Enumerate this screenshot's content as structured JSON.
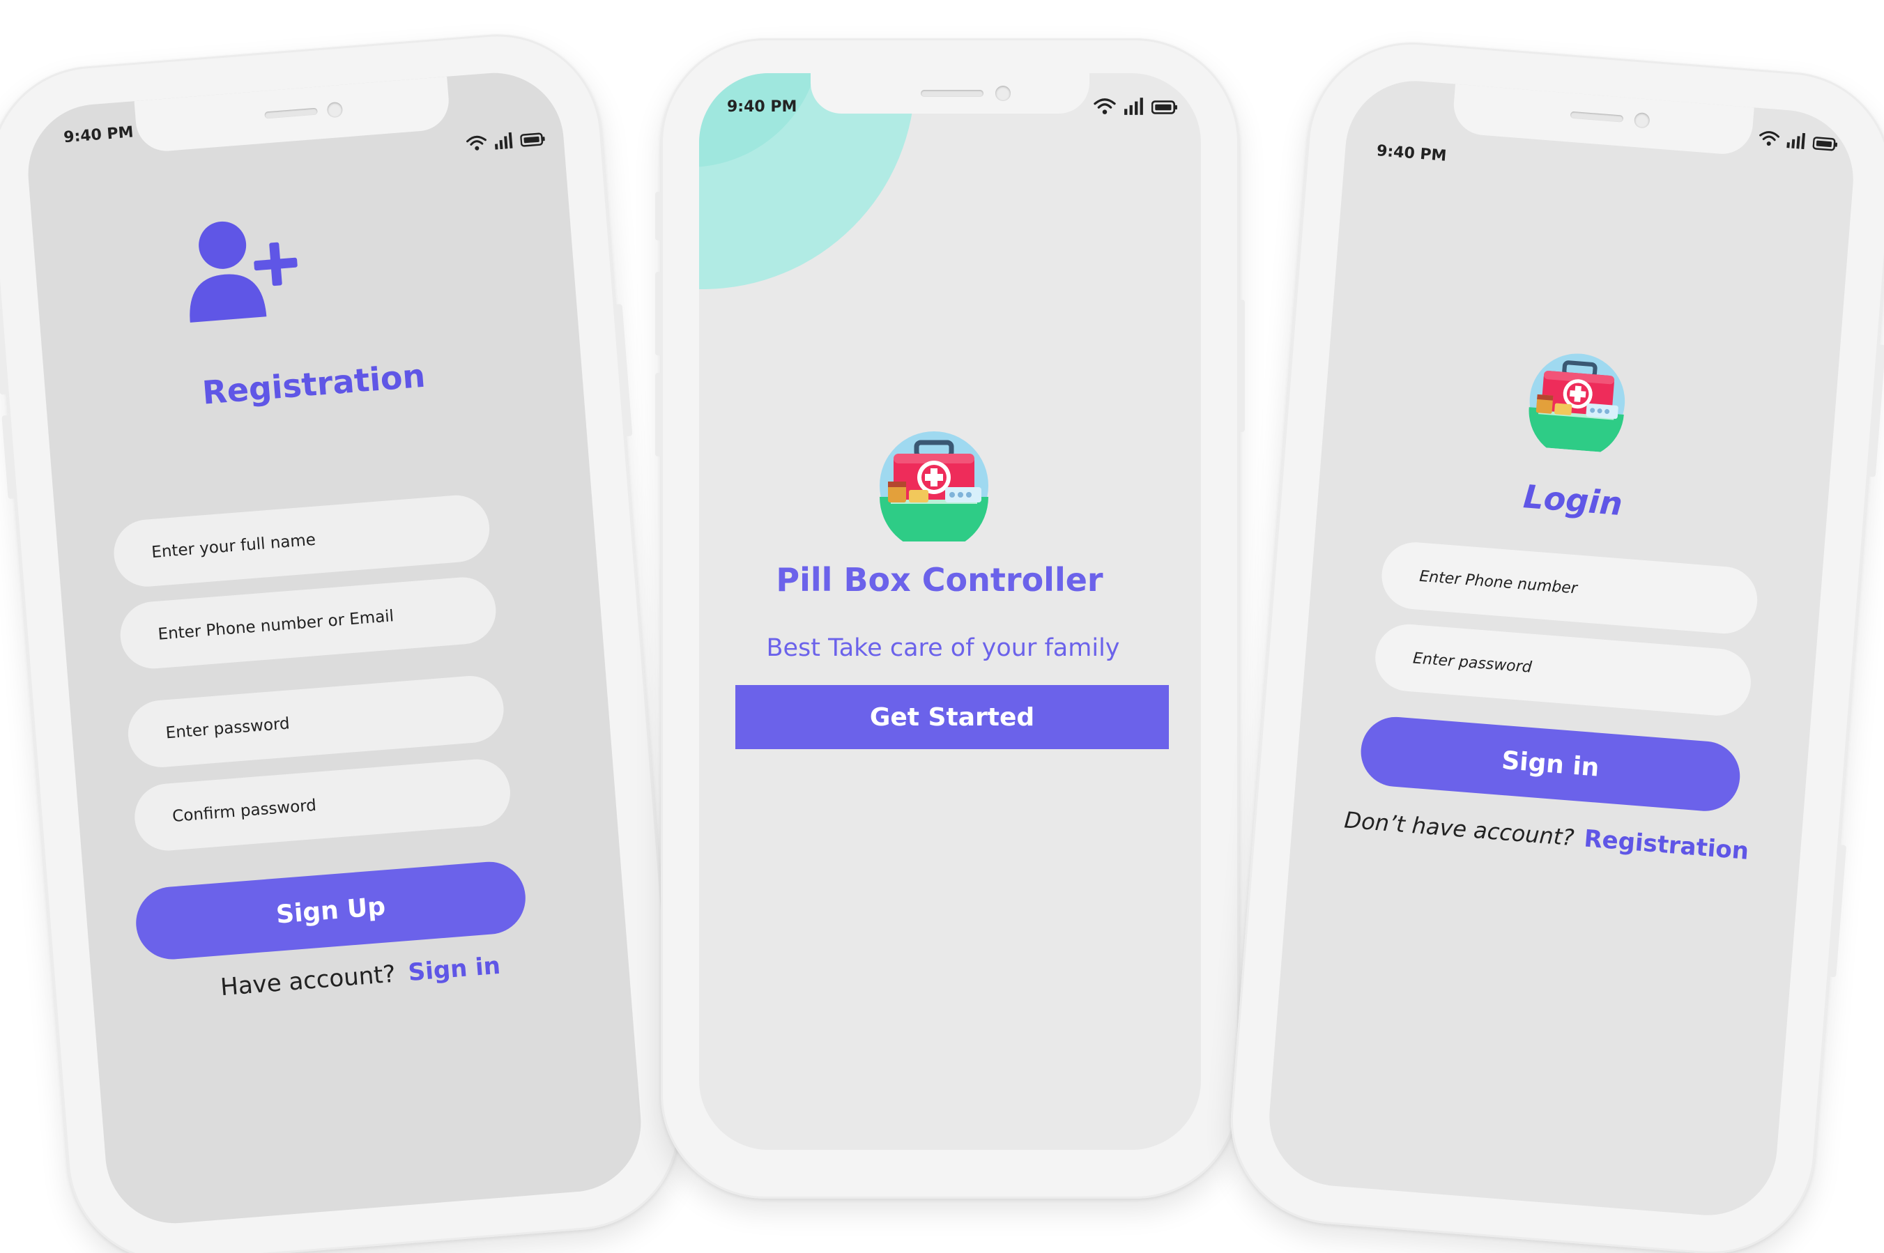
{
  "status_bar": {
    "time": "9:40 PM"
  },
  "registration_screen": {
    "title": "Registration",
    "icon": "add-user-icon",
    "fields": {
      "full_name_placeholder": "Enter your full name",
      "contact_placeholder": "Enter Phone number or Email",
      "password_placeholder": "Enter password",
      "confirm_password_placeholder": "Confirm password"
    },
    "sign_up_label": "Sign Up",
    "have_account_text": "Have account?",
    "sign_in_link": "Sign in"
  },
  "welcome_screen": {
    "app_title": "Pill Box Controller",
    "tagline": "Best Take care of your family",
    "get_started_label": "Get Started",
    "logo_icon": "first-aid-kit-icon"
  },
  "login_screen": {
    "title": "Login",
    "logo_icon": "first-aid-kit-icon",
    "fields": {
      "phone_placeholder": "Enter Phone number",
      "password_placeholder": "Enter password"
    },
    "sign_in_label": "Sign in",
    "no_account_text": "Don’t have account?",
    "registration_link": "Registration"
  },
  "colors": {
    "accent": "#6b62ea",
    "accent_text": "#5f56e6",
    "screen_bg": "#e9e9e9",
    "screen_bg_side": "#dcdcdc",
    "field_bg": "#efefef",
    "teal_decor": "#a7ebe3",
    "kit_red": "#ee2c5a",
    "kit_green": "#2ecc86",
    "kit_sky": "#9fd9f0"
  }
}
